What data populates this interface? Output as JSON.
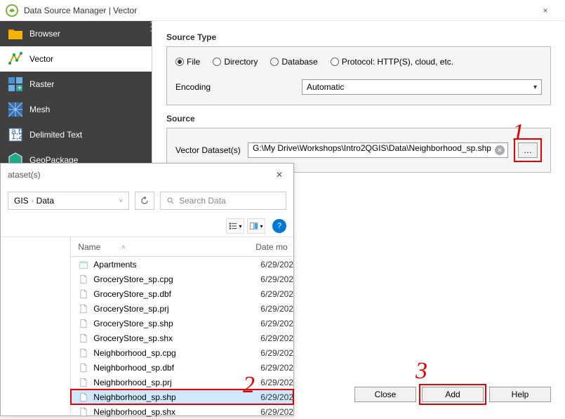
{
  "window": {
    "title": "Data Source Manager | Vector",
    "close_icon": "×"
  },
  "sidebar": {
    "items": [
      {
        "label": "Browser"
      },
      {
        "label": "Vector"
      },
      {
        "label": "Raster"
      },
      {
        "label": "Mesh"
      },
      {
        "label": "Delimited Text"
      },
      {
        "label": "GeoPackage"
      }
    ]
  },
  "source_type": {
    "heading": "Source Type",
    "options": [
      "File",
      "Directory",
      "Database",
      "Protocol: HTTP(S), cloud, etc."
    ],
    "selected": 0,
    "encoding_label": "Encoding",
    "encoding_value": "Automatic"
  },
  "source": {
    "heading": "Source",
    "dataset_label": "Vector Dataset(s)",
    "dataset_value": "G:\\My Drive\\Workshops\\Intro2QGIS\\Data\\Neighborhood_sp.shp",
    "browse_label": "…"
  },
  "filedialog": {
    "title": "ataset(s)",
    "crumbs": [
      "GIS",
      "Data"
    ],
    "search_placeholder": "Search Data",
    "columns": {
      "name": "Name",
      "date": "Date mo"
    },
    "files": [
      {
        "name": "Apartments",
        "date": "6/29/202",
        "type": "folder"
      },
      {
        "name": "GroceryStore_sp.cpg",
        "date": "6/29/202",
        "type": "file"
      },
      {
        "name": "GroceryStore_sp.dbf",
        "date": "6/29/202",
        "type": "file"
      },
      {
        "name": "GroceryStore_sp.prj",
        "date": "6/29/202",
        "type": "file"
      },
      {
        "name": "GroceryStore_sp.shp",
        "date": "6/29/202",
        "type": "file"
      },
      {
        "name": "GroceryStore_sp.shx",
        "date": "6/29/202",
        "type": "file"
      },
      {
        "name": "Neighborhood_sp.cpg",
        "date": "6/29/202",
        "type": "file"
      },
      {
        "name": "Neighborhood_sp.dbf",
        "date": "6/29/202",
        "type": "file"
      },
      {
        "name": "Neighborhood_sp.prj",
        "date": "6/29/202",
        "type": "file"
      },
      {
        "name": "Neighborhood_sp.shp",
        "date": "6/29/202",
        "type": "file",
        "selected": true
      },
      {
        "name": "Neighborhood_sp.shx",
        "date": "6/29/202",
        "type": "file"
      }
    ]
  },
  "footer": {
    "close": "Close",
    "add": "Add",
    "help": "Help"
  },
  "annotations": {
    "one": "1",
    "two": "2",
    "three": "3"
  }
}
